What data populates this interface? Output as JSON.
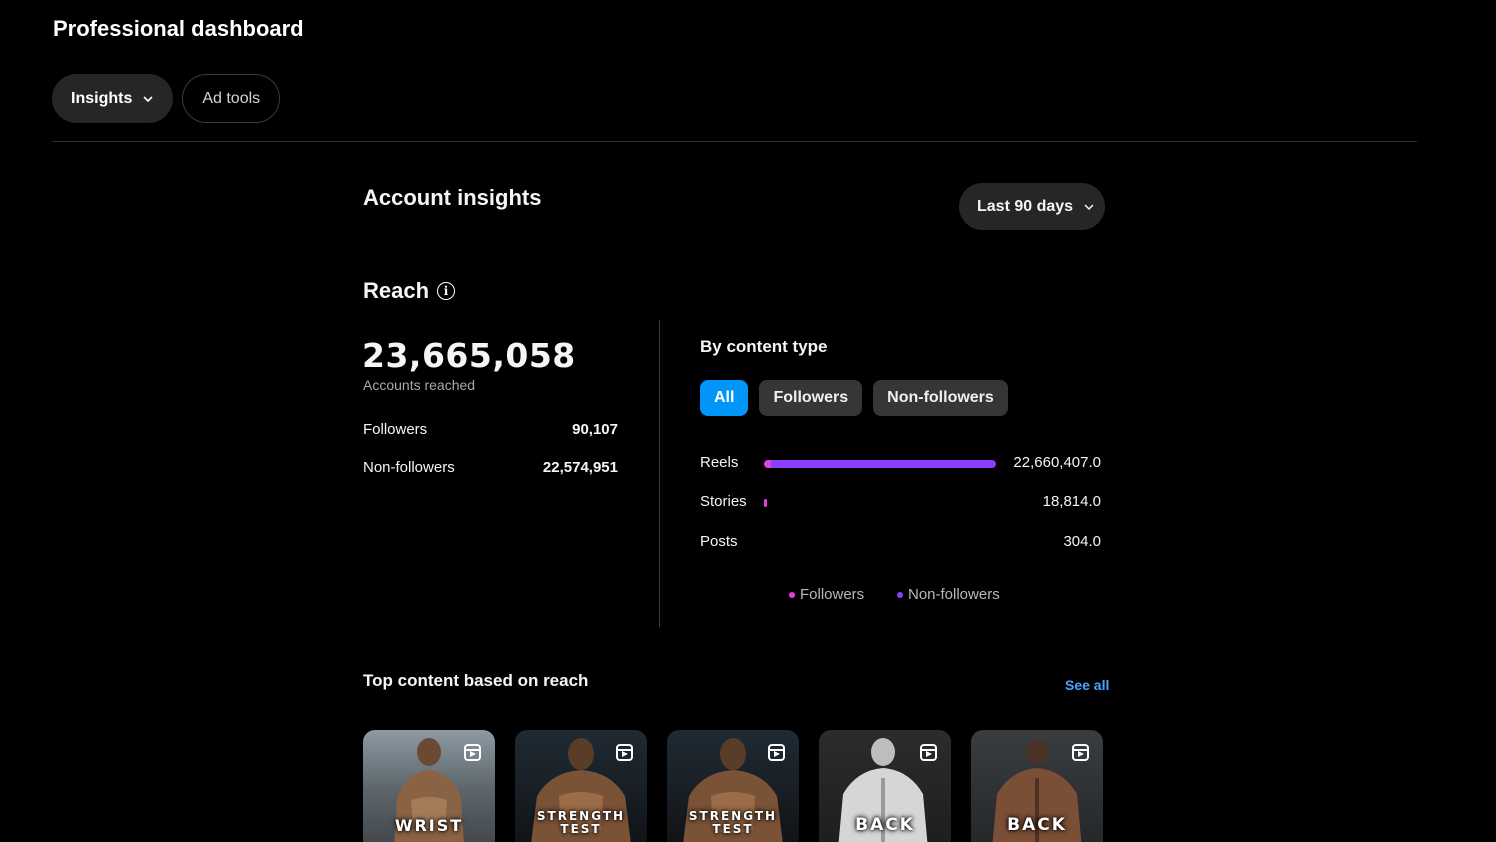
{
  "header": {
    "title": "Professional dashboard"
  },
  "tabs": [
    {
      "label": "Insights",
      "active": true
    },
    {
      "label": "Ad tools",
      "active": false
    }
  ],
  "insights": {
    "title": "Account insights",
    "date_range": "Last 90 days"
  },
  "reach": {
    "title": "Reach",
    "total": "23,665,058",
    "total_label": "Accounts reached",
    "breakdown": [
      {
        "label": "Followers",
        "value": "90,107"
      },
      {
        "label": "Non-followers",
        "value": "22,574,951"
      }
    ]
  },
  "by_content_type": {
    "title": "By content type",
    "filters": [
      {
        "label": "All",
        "active": true
      },
      {
        "label": "Followers",
        "active": false
      },
      {
        "label": "Non-followers",
        "active": false
      }
    ],
    "rows": [
      {
        "label": "Reels",
        "value": "22,660,407.0",
        "bar_fraction": 1.0,
        "followers_fraction": 0.03
      },
      {
        "label": "Stories",
        "value": "18,814.0",
        "bar_fraction": 0.0083,
        "followers_fraction": 1.0
      },
      {
        "label": "Posts",
        "value": "304.0",
        "bar_fraction": 0.0,
        "followers_fraction": 0.0
      }
    ],
    "legend": [
      {
        "label": "Followers",
        "color": "#e63de0"
      },
      {
        "label": "Non-followers",
        "color": "#8a3ffc"
      }
    ]
  },
  "top_content": {
    "title": "Top content based on reach",
    "see_all": "See all",
    "items": [
      {
        "caption": "WRIST",
        "type": "reel"
      },
      {
        "caption": "STRENGTH TEST",
        "type": "reel"
      },
      {
        "caption": "STRENGTH TEST",
        "type": "reel"
      },
      {
        "caption": "BACK",
        "type": "reel"
      },
      {
        "caption": "BACK",
        "type": "reel"
      }
    ]
  }
}
